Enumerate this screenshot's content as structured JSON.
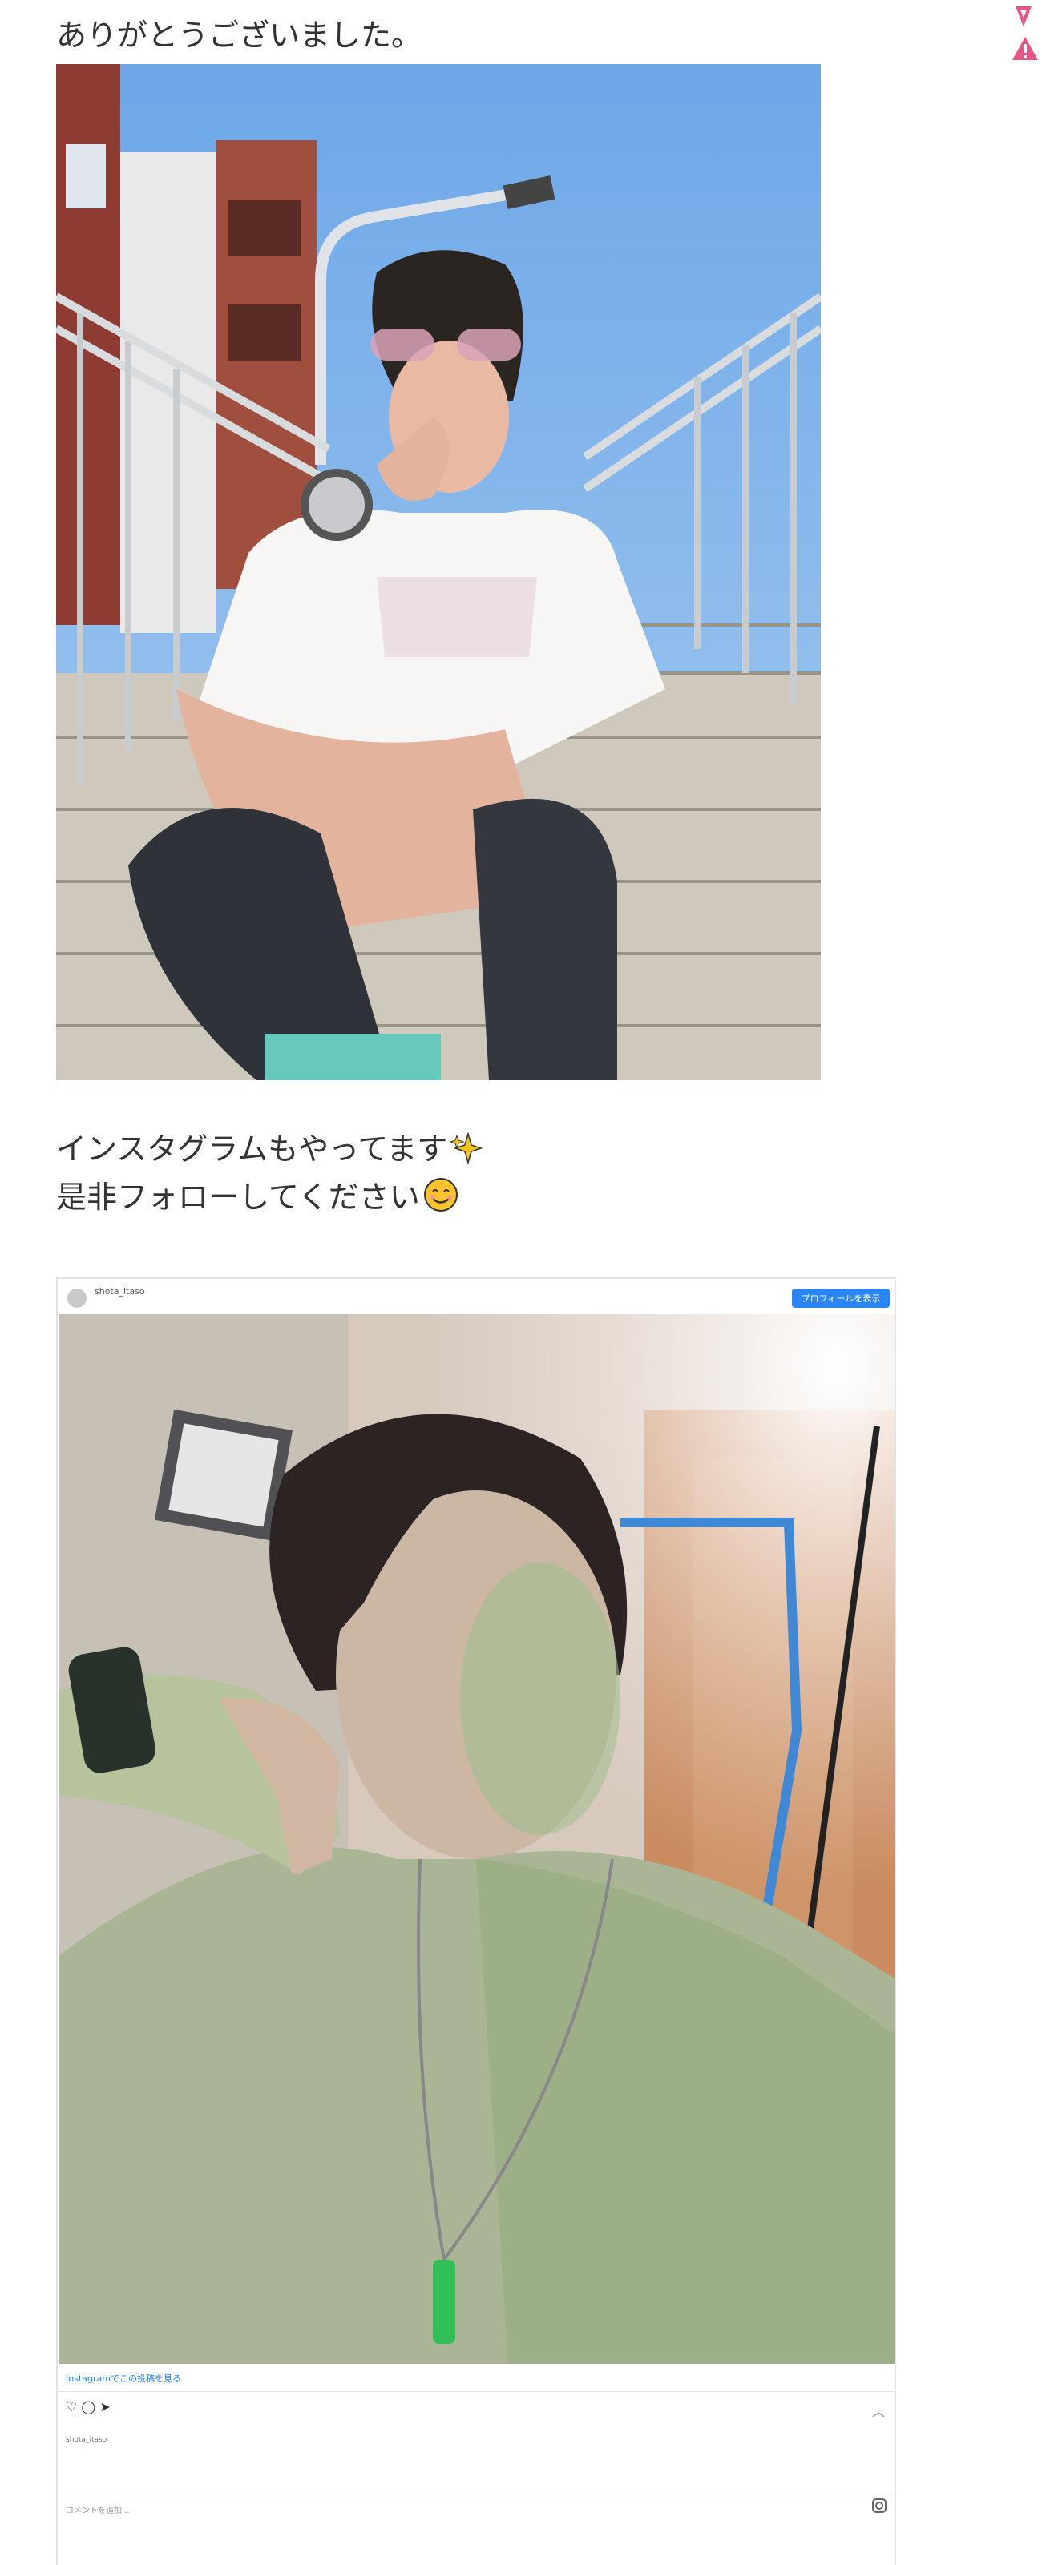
{
  "text_top": "ありがとうございました。",
  "text_insta_1": "インスタグラムもやってます",
  "text_insta_2": "是非フォローしてください",
  "emoji_sparkles": "sparkles-emoji",
  "emoji_smile": "smiling-face-emoji",
  "side_icons": [
    "pink-ribbon-icon",
    "warning-triangle-icon"
  ],
  "instagram_embed": {
    "username": "shota_itaso",
    "follow_label": "プロフィールを表示",
    "view_more_label": "Instagramでこの投稿を見る",
    "comment_placeholder": "コメントを追加...",
    "caption_user": "shota_itaso"
  },
  "colors": {
    "text": "#333333",
    "follow_button": "#2a86f7",
    "warning": "#e95585"
  }
}
